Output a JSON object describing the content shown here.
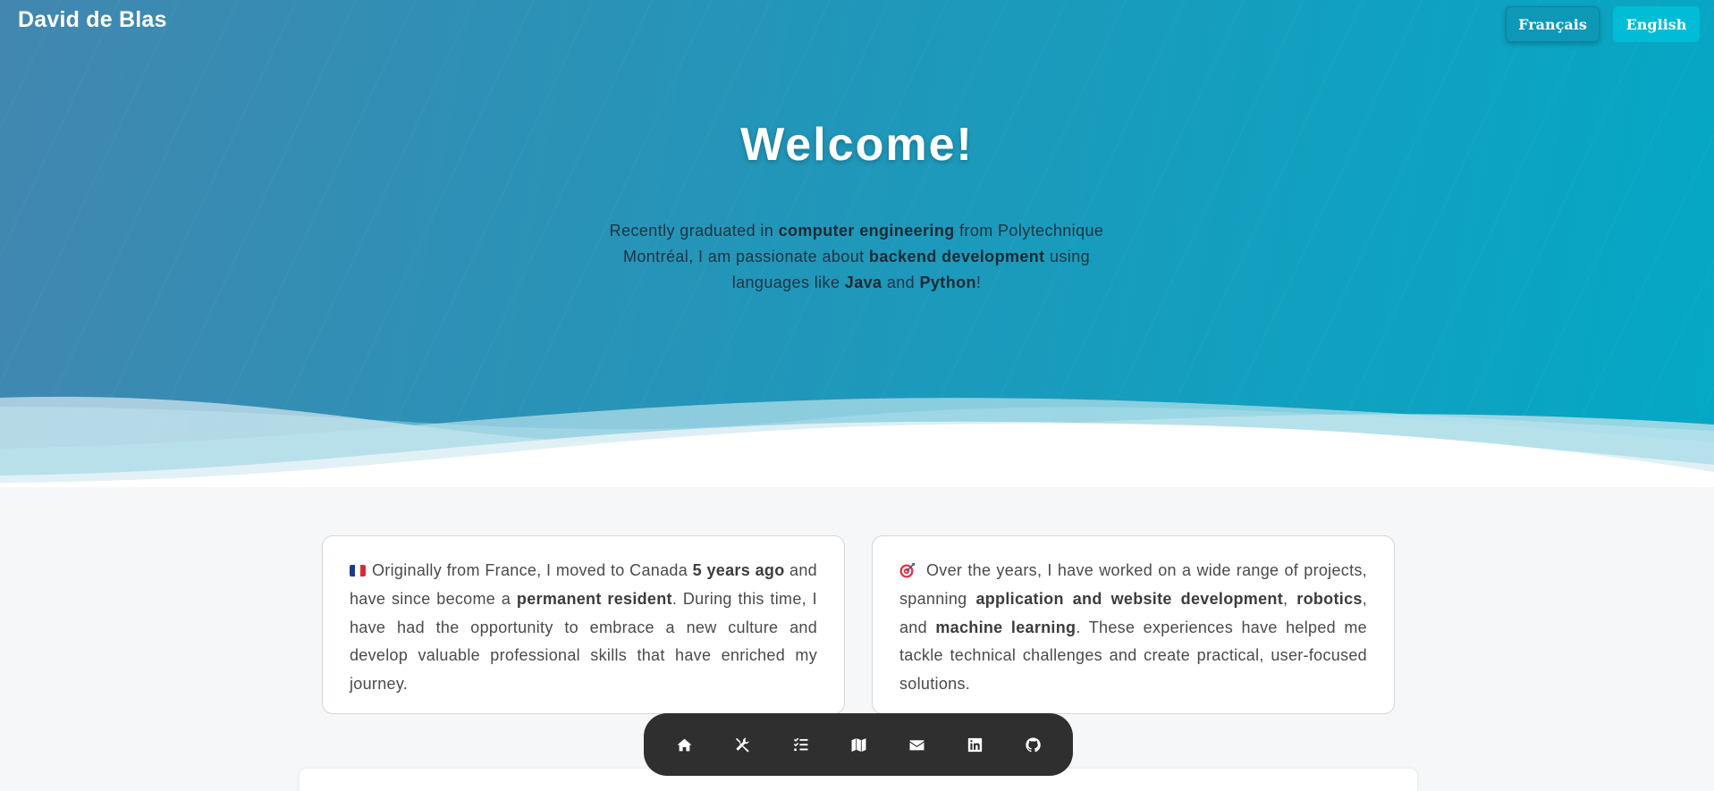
{
  "header": {
    "brand": "David de Blas",
    "lang_fr": "Français",
    "lang_en": "English"
  },
  "hero": {
    "title": "Welcome!",
    "intro": {
      "p1": "Recently graduated in ",
      "b1": "computer engineering",
      "p2": " from Polytechnique Montréal, I am passionate about ",
      "b2": "backend development",
      "p3": " using languages like ",
      "b3": "Java",
      "p4": " and ",
      "b4": "Python",
      "p5": "!"
    }
  },
  "cards": [
    {
      "icon": "france-flag-icon",
      "t1": "Originally from France, I moved to Canada ",
      "b1": "5 years ago",
      "t2": " and have since become a ",
      "b2": "permanent resident",
      "t3": ". During this time, I have had the opportunity to embrace a new culture and develop valuable professional skills that have enriched my journey."
    },
    {
      "icon": "target-icon",
      "t1": "Over the years, I have worked on a wide range of projects, spanning ",
      "b1": "application and website development",
      "t2": ", ",
      "b2": "robotics",
      "t3": ", and ",
      "b3": "machine learning",
      "t4": ". These experiences have helped me tackle technical challenges and create practical, user-focused solutions."
    }
  ],
  "dock": {
    "items": [
      "home-icon",
      "tools-icon",
      "checklist-icon",
      "map-icon",
      "envelope-icon",
      "linkedin-icon",
      "github-icon"
    ]
  },
  "colors": {
    "hero_start": "#4287b0",
    "hero_end": "#04a8c5",
    "lang_fr_bg": "#0e98b8",
    "lang_en_bg": "#00bcd6",
    "dock_bg": "#2f2f2f",
    "page_bg": "#f5f7f9"
  }
}
